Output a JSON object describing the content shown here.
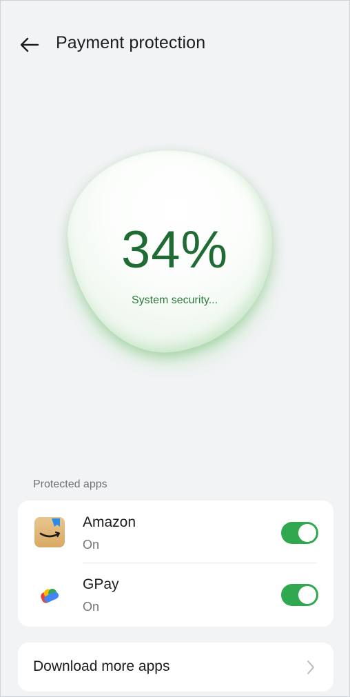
{
  "header": {
    "title": "Payment protection",
    "back_icon": "arrow-left-icon"
  },
  "scan": {
    "percent": "34%",
    "status": "System security...",
    "progress": 0.34,
    "accent": "#2fa84f",
    "text_color": "#1f6b33"
  },
  "protected_apps": {
    "label": "Protected apps",
    "items": [
      {
        "name": "Amazon",
        "state": "On",
        "enabled": true,
        "icon": "amazon-app-icon"
      },
      {
        "name": "GPay",
        "state": "On",
        "enabled": true,
        "icon": "gpay-app-icon"
      }
    ]
  },
  "download": {
    "label": "Download more apps",
    "icon": "chevron-right-icon"
  }
}
